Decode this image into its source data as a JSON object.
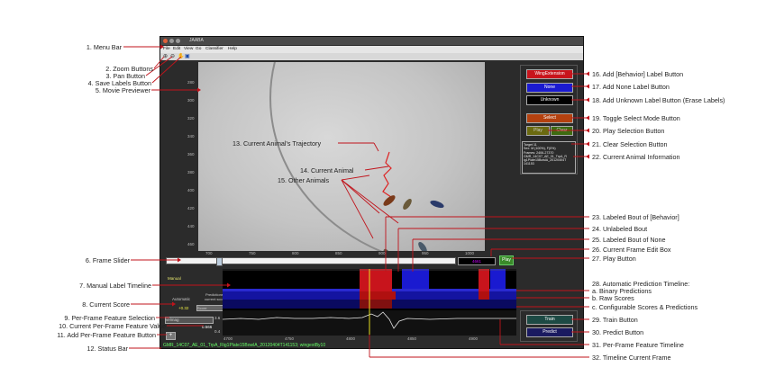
{
  "window": {
    "title": "JAABA",
    "menu": [
      "File",
      "Edit",
      "View",
      "Go",
      "Classifier",
      "Help"
    ]
  },
  "movie": {
    "y_ticks": [
      "280",
      "300",
      "320",
      "340",
      "360",
      "380",
      "400",
      "420",
      "440",
      "460"
    ],
    "x_ticks": [
      "700",
      "750",
      "800",
      "850",
      "900",
      "950",
      "1000"
    ]
  },
  "frame_slider": {
    "edit_value": "4661",
    "play_label": "Play"
  },
  "labels_panel": {
    "behavior_button": "WingExtension",
    "none_button": "None",
    "unknown_button": "Unknown",
    "select_button": "Select",
    "play_selection_button": "Play",
    "clear_selection_button": "Clear"
  },
  "animal_info": {
    "lines": [
      "Target 11",
      "Sex: M (100%), F(0%)",
      "Frames: 2406-27370",
      "GMR_14C07_AE_01_TrpA_R",
      "ig1Plate15BowlA_20120404T",
      "141153"
    ]
  },
  "timeline": {
    "manual_label": "Manual",
    "automatic_label": "Automatic",
    "predictions_label": "Predictions",
    "current_scores_label": "current scores",
    "score_label": "Score",
    "score_value": "+0.32",
    "feature_select": "velmag",
    "feature_value": "0.566",
    "feature_axis_top": "3.6",
    "feature_axis_bottom": "0.4",
    "x_ticks": [
      "4700",
      "4750",
      "4800",
      "4850",
      "4900"
    ]
  },
  "train_panel": {
    "train_button": "Train",
    "predict_button": "Predict"
  },
  "status_bar": "GMR_14C07_AE_01_TrpA_Rig1Plate15BowlA_20120404T141153; wingextBy10",
  "callouts_left": [
    "1. Menu Bar",
    "2. Zoom Buttons",
    "3. Pan Button",
    "4. Save Labels Button",
    "5. Movie Previewer",
    "6. Frame Slider",
    "7. Manual Label Timeline",
    "8. Current Score",
    "9. Per-Frame Feature Selection",
    "10. Current Per-Frame Feature Value",
    "11. Add Per-Frame Feature Button",
    "12. Status Bar"
  ],
  "callouts_movie": [
    "13. Current Animal's Trajectory",
    "14. Current Animal",
    "15. Other Animals"
  ],
  "callouts_right": [
    "16. Add [Behavior] Label Button",
    "17. Add None Label Button",
    "18. Add Unknown Label Button (Erase Labels)",
    "19. Toggle Select Mode Button",
    "20. Play Selection Button",
    "21. Clear Selection Button",
    "22. Current Animal Information",
    "23. Labeled Bout of [Behavior]",
    "24. Unlabeled Bout",
    "25. Labeled Bout of None",
    "26. Current Frame Edit Box",
    "27. Play Button",
    "28. Automatic Prediction Timeline:",
    "a. Binary Predictions",
    "b. Raw Scores",
    "c. Configurable Scores & Predictions",
    "29. Train Button",
    "30. Predict Button",
    "31. Per-Frame Feature Timeline",
    "32. Timeline Current Frame"
  ],
  "colors": {
    "callout_line": "#c0131b",
    "behavior": "#c8141c",
    "none": "#1a1ad0",
    "play_green": "#3a8a2a"
  }
}
